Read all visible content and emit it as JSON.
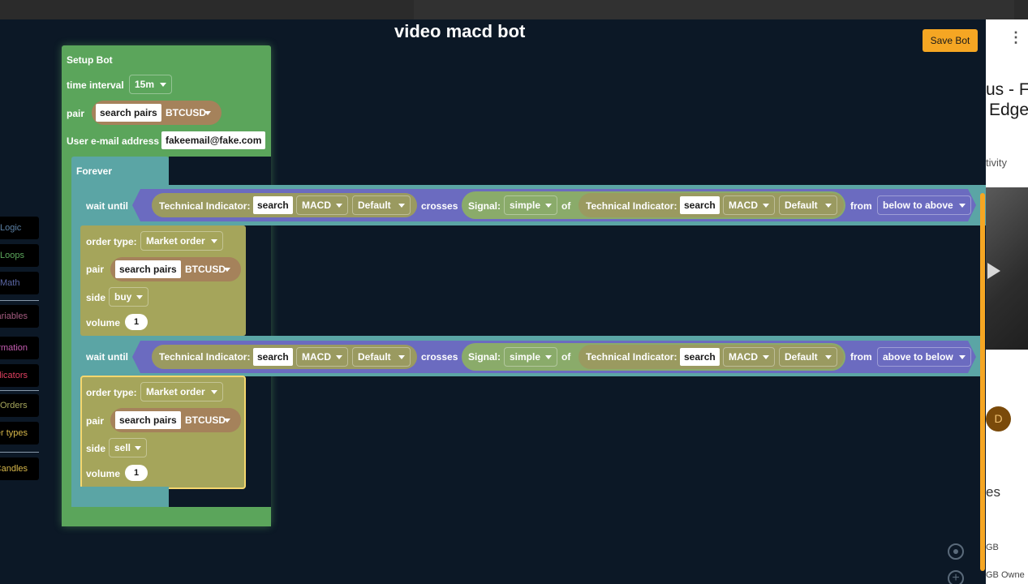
{
  "workspace": {
    "title": "video macd bot",
    "save_label": "Save Bot"
  },
  "categories": [
    {
      "label": "Logic",
      "color": "#5b80a5"
    },
    {
      "label": "Loops",
      "color": "#5ba55b"
    },
    {
      "label": "Math",
      "color": "#5b67a5"
    },
    {
      "label": "Variables",
      "color": "#a55b80"
    },
    {
      "label": "Bot information",
      "color": "#c45bb0"
    },
    {
      "label": "Technical Indicators",
      "color": "#e04060"
    },
    {
      "label": "Orders",
      "color": "#a5a55b"
    },
    {
      "label": "Order types",
      "color": "#d8b84a"
    },
    {
      "label": "Candles",
      "color": "#d8b84a"
    }
  ],
  "setup": {
    "header": "Setup Bot",
    "time_interval_label": "time interval",
    "time_interval_value": "15m",
    "pair_label": "pair",
    "search_pairs": "search pairs",
    "pair_value": "BTCUSD",
    "email_label": "User e-mail address",
    "email_value": "fakeemail@fake.com"
  },
  "forever": {
    "label": "Forever"
  },
  "conditions": [
    {
      "wait_label": "wait until",
      "ti_label": "Technical Indicator:",
      "ti_search": "search",
      "ti_value": "MACD",
      "ti_default": "Default",
      "crosses": "crosses",
      "signal_label": "Signal:",
      "signal_value": "simple",
      "of_label": "of",
      "ti2_label": "Technical Indicator:",
      "ti2_search": "search",
      "ti2_value": "MACD",
      "ti2_default": "Default",
      "from_label": "from",
      "direction": "below to above"
    },
    {
      "wait_label": "wait until",
      "ti_label": "Technical Indicator:",
      "ti_search": "search",
      "ti_value": "MACD",
      "ti_default": "Default",
      "crosses": "crosses",
      "signal_label": "Signal:",
      "signal_value": "simple",
      "of_label": "of",
      "ti2_label": "Technical Indicator:",
      "ti2_search": "search",
      "ti2_value": "MACD",
      "ti2_default": "Default",
      "from_label": "from",
      "direction": "above to below"
    }
  ],
  "orders": [
    {
      "order_type_label": "order type:",
      "order_type_value": "Market order",
      "pair_label": "pair",
      "search_pairs": "search pairs",
      "pair_value": "BTCUSD",
      "side_label": "side",
      "side_value": "buy",
      "volume_label": "volume",
      "volume_value": "1"
    },
    {
      "order_type_label": "order type:",
      "order_type_value": "Market order",
      "pair_label": "pair",
      "search_pairs": "search pairs",
      "pair_value": "BTCUSD",
      "side_label": "side",
      "side_value": "sell",
      "volume_label": "volume",
      "volume_value": "1"
    }
  ],
  "background_page": {
    "title_line1": "us - Fi",
    "title_line2": "Edge",
    "activity": "tivity",
    "avatar_letter": "D",
    "es_text": "es",
    "gb1": "GB",
    "gb2": "GB Owne"
  },
  "icons": {
    "menu": "more-vert-icon",
    "play": "play-icon",
    "target": "center-target-icon",
    "zoom_in": "zoom-in-icon"
  }
}
